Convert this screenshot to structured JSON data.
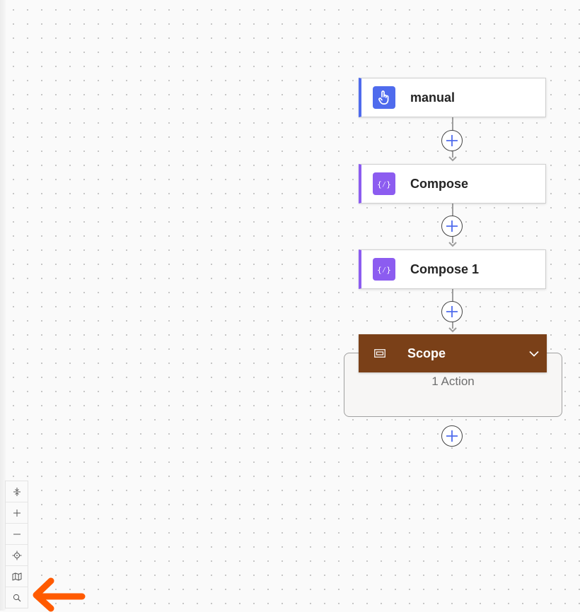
{
  "flow": {
    "nodes": [
      {
        "label": "manual",
        "kind": "trigger",
        "icon": "touch-hand-icon",
        "accent": "#4f6bed"
      },
      {
        "label": "Compose",
        "kind": "compose",
        "icon": "curly-braces-icon",
        "accent": "#8c5cf0"
      },
      {
        "label": "Compose 1",
        "kind": "compose",
        "icon": "curly-braces-icon",
        "accent": "#8c5cf0"
      }
    ],
    "scope": {
      "label": "Scope",
      "action_count": "1 Action",
      "color": "#7a4018",
      "icon": "scope-container-icon",
      "collapse_icon": "chevron-down-icon"
    },
    "add_button_icon": "plus-circle-icon"
  },
  "toolbar": {
    "buttons": [
      {
        "name": "fit-view-button",
        "icon": "fit-view-icon"
      },
      {
        "name": "zoom-in-button",
        "icon": "plus-icon"
      },
      {
        "name": "zoom-out-button",
        "icon": "minus-icon"
      },
      {
        "name": "center-view-button",
        "icon": "crosshair-icon"
      },
      {
        "name": "minimap-button",
        "icon": "map-icon"
      },
      {
        "name": "search-button",
        "icon": "search-icon"
      }
    ]
  },
  "colors": {
    "trigger_accent": "#4f6bed",
    "compose_accent": "#8c5cf0",
    "scope": "#7a4018",
    "annotation": "#ff5a00"
  }
}
